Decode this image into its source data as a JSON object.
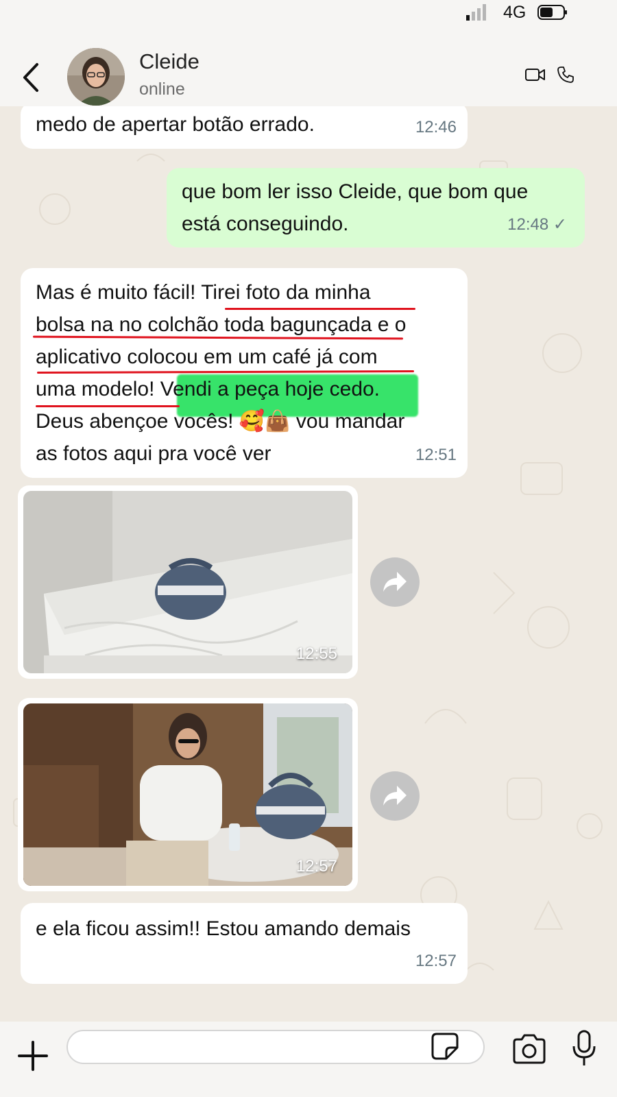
{
  "status_bar": {
    "network": "4G"
  },
  "header": {
    "contact_name": "Cleide",
    "contact_status": "online",
    "icons": [
      "back-arrow-icon",
      "video-call-icon",
      "phone-call-icon"
    ]
  },
  "messages": [
    {
      "direction": "in",
      "text": "medo de apertar botão errado.",
      "time": "12:46"
    },
    {
      "direction": "out",
      "lines": [
        "que bom ler isso Cleide, que bom que",
        "está conseguindo."
      ],
      "time": "12:48",
      "status": "✓"
    },
    {
      "direction": "in",
      "lines": [
        "Mas é muito fácil! Tirei foto da minha",
        "bolsa na no colchão toda bagunçada e o",
        "aplicativo colocou em um café já com",
        "uma modelo! Vendi a peça hoje cedo.",
        "Deus abençoe vocês! 🥰👜 vou mandar",
        "as fotos aqui pra você ver"
      ],
      "time": "12:51"
    },
    {
      "direction": "in",
      "type": "image",
      "description_icon": "photo-bag-on-bed",
      "time": "12:55"
    },
    {
      "direction": "in",
      "type": "image",
      "description_icon": "photo-model-in-cafe",
      "time": "12:57"
    },
    {
      "direction": "in",
      "text": "e ela ficou assim!! Estou amando demais",
      "time": "12:57"
    }
  ],
  "colors": {
    "incoming_bubble": "#ffffff",
    "outgoing_bubble": "#d9fdd3",
    "underline_annotation": "#e0131e",
    "highlight_annotation": "#22e05a"
  }
}
